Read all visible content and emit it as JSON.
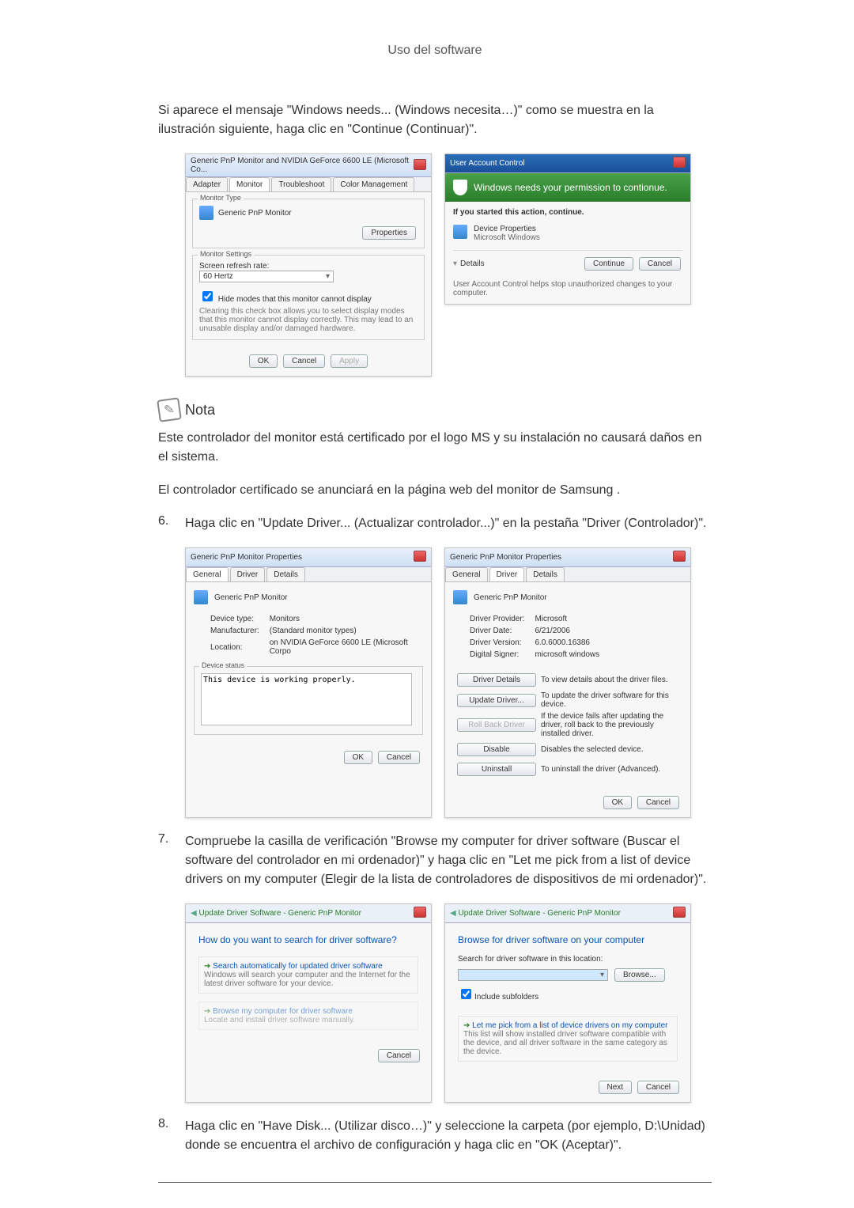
{
  "header": {
    "title": "Uso del software"
  },
  "intro": "Si aparece el mensaje \"Windows needs... (Windows necesita…)\" como se muestra en la ilustración siguiente, haga clic en \"Continue (Continuar)\".",
  "fig1": {
    "title": "Generic PnP Monitor and NVIDIA GeForce 6600 LE (Microsoft Co...",
    "tabs": {
      "adapter": "Adapter",
      "monitor": "Monitor",
      "troubleshoot": "Troubleshoot",
      "color": "Color Management"
    },
    "monitor_type_label": "Monitor Type",
    "monitor_name": "Generic PnP Monitor",
    "properties_btn": "Properties",
    "settings_label": "Monitor Settings",
    "refresh_label": "Screen refresh rate:",
    "refresh_value": "60 Hertz",
    "hide_modes": "Hide modes that this monitor cannot display",
    "hide_desc": "Clearing this check box allows you to select display modes that this monitor cannot display correctly. This may lead to an unusable display and/or damaged hardware.",
    "ok": "OK",
    "cancel": "Cancel",
    "apply": "Apply"
  },
  "uac": {
    "title": "User Account Control",
    "headline": "Windows needs your permission to contionue.",
    "started": "If you started this action, continue.",
    "item_title": "Device Properties",
    "item_sub": "Microsoft Windows",
    "details": "Details",
    "continue": "Continue",
    "cancel": "Cancel",
    "footnote": "User Account Control helps stop unauthorized changes to your computer."
  },
  "note": {
    "label": "Nota",
    "p1": "Este controlador del monitor está certificado por el logo MS y su instalación no causará daños en el sistema.",
    "p2": "El controlador certificado se anunciará en la página web del monitor de Samsung ."
  },
  "step6": {
    "num": "6.",
    "text": "Haga clic en \"Update Driver... (Actualizar controlador...)\" en la pestaña \"Driver (Controlador)\"."
  },
  "props_general": {
    "title": "Generic PnP Monitor Properties",
    "tab_general": "General",
    "tab_driver": "Driver",
    "tab_details": "Details",
    "name": "Generic PnP Monitor",
    "devtype_l": "Device type:",
    "devtype_v": "Monitors",
    "mfr_l": "Manufacturer:",
    "mfr_v": "(Standard monitor types)",
    "loc_l": "Location:",
    "loc_v": "on NVIDIA GeForce 6600 LE (Microsoft Corpo",
    "status_l": "Device status",
    "status_v": "This device is working properly.",
    "ok": "OK",
    "cancel": "Cancel"
  },
  "props_driver": {
    "title": "Generic PnP Monitor Properties",
    "name": "Generic PnP Monitor",
    "prov_l": "Driver Provider:",
    "prov_v": "Microsoft",
    "date_l": "Driver Date:",
    "date_v": "6/21/2006",
    "ver_l": "Driver Version:",
    "ver_v": "6.0.6000.16386",
    "sign_l": "Digital Signer:",
    "sign_v": "microsoft windows",
    "btn_details": "Driver Details",
    "btn_details_d": "To view details about the driver files.",
    "btn_update": "Update Driver...",
    "btn_update_d": "To update the driver software for this device.",
    "btn_roll": "Roll Back Driver",
    "btn_roll_d": "If the device fails after updating the driver, roll back to the previously installed driver.",
    "btn_disable": "Disable",
    "btn_disable_d": "Disables the selected device.",
    "btn_uninstall": "Uninstall",
    "btn_uninstall_d": "To uninstall the driver (Advanced).",
    "ok": "OK",
    "cancel": "Cancel"
  },
  "step7": {
    "num": "7.",
    "text": "Compruebe la casilla de verificación \"Browse my computer for driver software (Buscar el software del controlador en mi ordenador)\" y haga clic en \"Let me pick from a list of device drivers on my computer (Elegir de la lista de controladores de dispositivos de mi ordenador)\"."
  },
  "wiz1": {
    "bc": "Update Driver Software - Generic PnP Monitor",
    "heading": "How do you want to search for driver software?",
    "opt1_t": "Search automatically for updated driver software",
    "opt1_d": "Windows will search your computer and the Internet for the latest driver software for your device.",
    "opt2_t": "Browse my computer for driver software",
    "opt2_d": "Locate and install driver software manually.",
    "cancel": "Cancel"
  },
  "wiz2": {
    "bc": "Update Driver Software - Generic PnP Monitor",
    "heading": "Browse for driver software on your computer",
    "loc_label": "Search for driver software in this location:",
    "browse": "Browse...",
    "include": "Include subfolders",
    "opt_t": "Let me pick from a list of device drivers on my computer",
    "opt_d": "This list will show installed driver software compatible with the device, and all driver software in the same category as the device.",
    "next": "Next",
    "cancel": "Cancel"
  },
  "step8": {
    "num": "8.",
    "text": "Haga clic en \"Have Disk... (Utilizar disco…)\" y seleccione la carpeta (por ejemplo, D:\\Unidad) donde se encuentra el archivo de configuración y haga clic en \"OK (Aceptar)\"."
  }
}
